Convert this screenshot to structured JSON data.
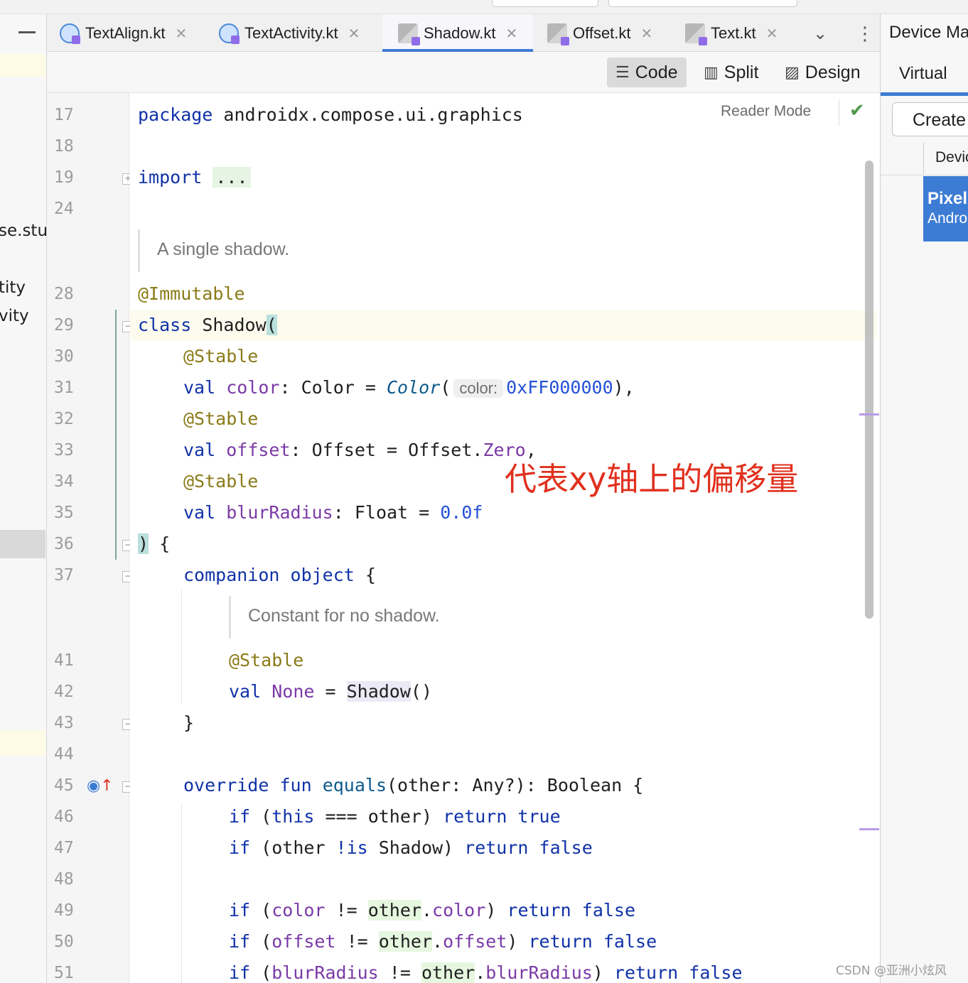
{
  "tabs": [
    {
      "label": "TextAlign.kt",
      "icon": "compose-file-icon"
    },
    {
      "label": "TextActivity.kt",
      "icon": "compose-file-icon"
    },
    {
      "label": "Shadow.kt",
      "icon": "kotlin-file-icon",
      "active": true
    },
    {
      "label": "Offset.kt",
      "icon": "kotlin-file-icon"
    },
    {
      "label": "Text.kt",
      "icon": "kotlin-file-icon"
    }
  ],
  "tab_close_glyph": "✕",
  "project_tree": {
    "items": [
      "se.stu",
      "tity",
      "vity"
    ]
  },
  "editor_modes": {
    "code": "Code",
    "split": "Split",
    "design": "Design"
  },
  "editor": {
    "reader_mode": "Reader Mode",
    "line_numbers": [
      "17",
      "18",
      "19",
      "24",
      "28",
      "29",
      "30",
      "31",
      "32",
      "33",
      "34",
      "35",
      "36",
      "37",
      "41",
      "42",
      "43",
      "44",
      "45",
      "46",
      "47",
      "48",
      "49",
      "50",
      "51"
    ],
    "doc_single_shadow": "A single shadow.",
    "doc_constant": "Constant for no shadow.",
    "inlay_hint_color": "color:"
  },
  "annotation_text": "代表xy轴上的偏移量",
  "device_manager": {
    "title": "Device Manager",
    "tab_virtual": "Virtual",
    "create_button": "Create device",
    "column_device": "Device",
    "device_name": "Pixel",
    "device_sub": "Android"
  },
  "watermark": "CSDN @亚洲小炫风",
  "colors": {
    "keyword": "#1032a8",
    "annotation": "#8a7a18",
    "property": "#7a3aa6",
    "number": "#2250d6",
    "accent": "#3d7cd4",
    "annotation_red": "#e0301e"
  }
}
